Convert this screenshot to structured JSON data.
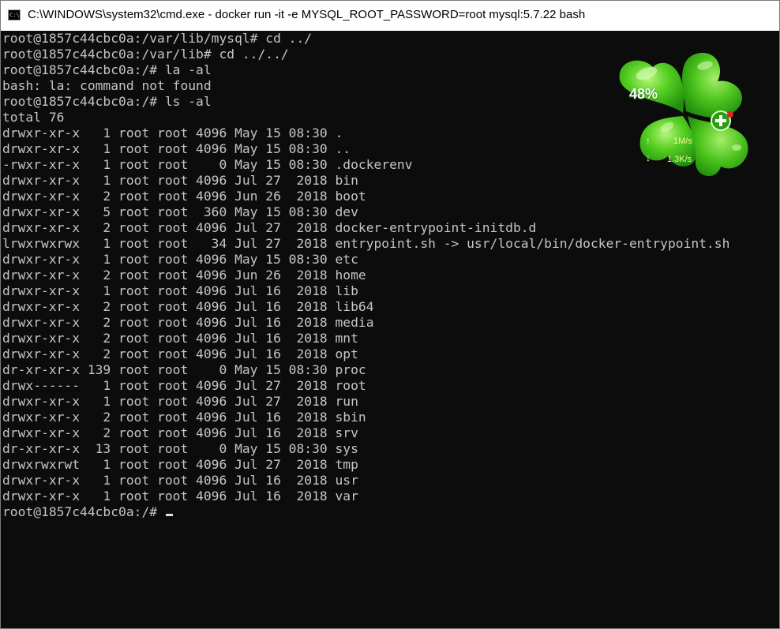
{
  "window": {
    "title": "C:\\WINDOWS\\system32\\cmd.exe - docker  run -it -e MYSQL_ROOT_PASSWORD=root mysql:5.7.22 bash",
    "icon": "cmd-app-icon",
    "icon_text": "C:\\"
  },
  "terminal": {
    "lines": [
      "root@1857c44cbc0a:/var/lib/mysql# cd ../",
      "root@1857c44cbc0a:/var/lib# cd ../../",
      "root@1857c44cbc0a:/# la -al",
      "bash: la: command not found",
      "root@1857c44cbc0a:/# ls -al",
      "total 76",
      "drwxr-xr-x   1 root root 4096 May 15 08:30 .",
      "drwxr-xr-x   1 root root 4096 May 15 08:30 ..",
      "-rwxr-xr-x   1 root root    0 May 15 08:30 .dockerenv",
      "drwxr-xr-x   1 root root 4096 Jul 27  2018 bin",
      "drwxr-xr-x   2 root root 4096 Jun 26  2018 boot",
      "drwxr-xr-x   5 root root  360 May 15 08:30 dev",
      "drwxr-xr-x   2 root root 4096 Jul 27  2018 docker-entrypoint-initdb.d",
      "lrwxrwxrwx   1 root root   34 Jul 27  2018 entrypoint.sh -> usr/local/bin/docker-entrypoint.sh",
      "drwxr-xr-x   1 root root 4096 May 15 08:30 etc",
      "drwxr-xr-x   2 root root 4096 Jun 26  2018 home",
      "drwxr-xr-x   1 root root 4096 Jul 16  2018 lib",
      "drwxr-xr-x   2 root root 4096 Jul 16  2018 lib64",
      "drwxr-xr-x   2 root root 4096 Jul 16  2018 media",
      "drwxr-xr-x   2 root root 4096 Jul 16  2018 mnt",
      "drwxr-xr-x   2 root root 4096 Jul 16  2018 opt",
      "dr-xr-xr-x 139 root root    0 May 15 08:30 proc",
      "drwx------   1 root root 4096 Jul 27  2018 root",
      "drwxr-xr-x   1 root root 4096 Jul 27  2018 run",
      "drwxr-xr-x   2 root root 4096 Jul 16  2018 sbin",
      "drwxr-xr-x   2 root root 4096 Jul 16  2018 srv",
      "dr-xr-xr-x  13 root root    0 May 15 08:30 sys",
      "drwxrwxrwt   1 root root 4096 Jul 27  2018 tmp",
      "drwxr-xr-x   1 root root 4096 Jul 16  2018 usr",
      "drwxr-xr-x   1 root root 4096 Jul 16  2018 var"
    ],
    "prompt": "root@1857c44cbc0a:/# ",
    "colors": {
      "background": "#0c0c0c",
      "foreground": "#c5c5c5"
    }
  },
  "widget": {
    "name": "network-monitor-clover",
    "percent": "48%",
    "upload_arrow": "↑",
    "upload_speed": "1M/s",
    "download_arrow": "↓",
    "download_speed": "1.3K/s",
    "accent_color": "#39b81c"
  }
}
